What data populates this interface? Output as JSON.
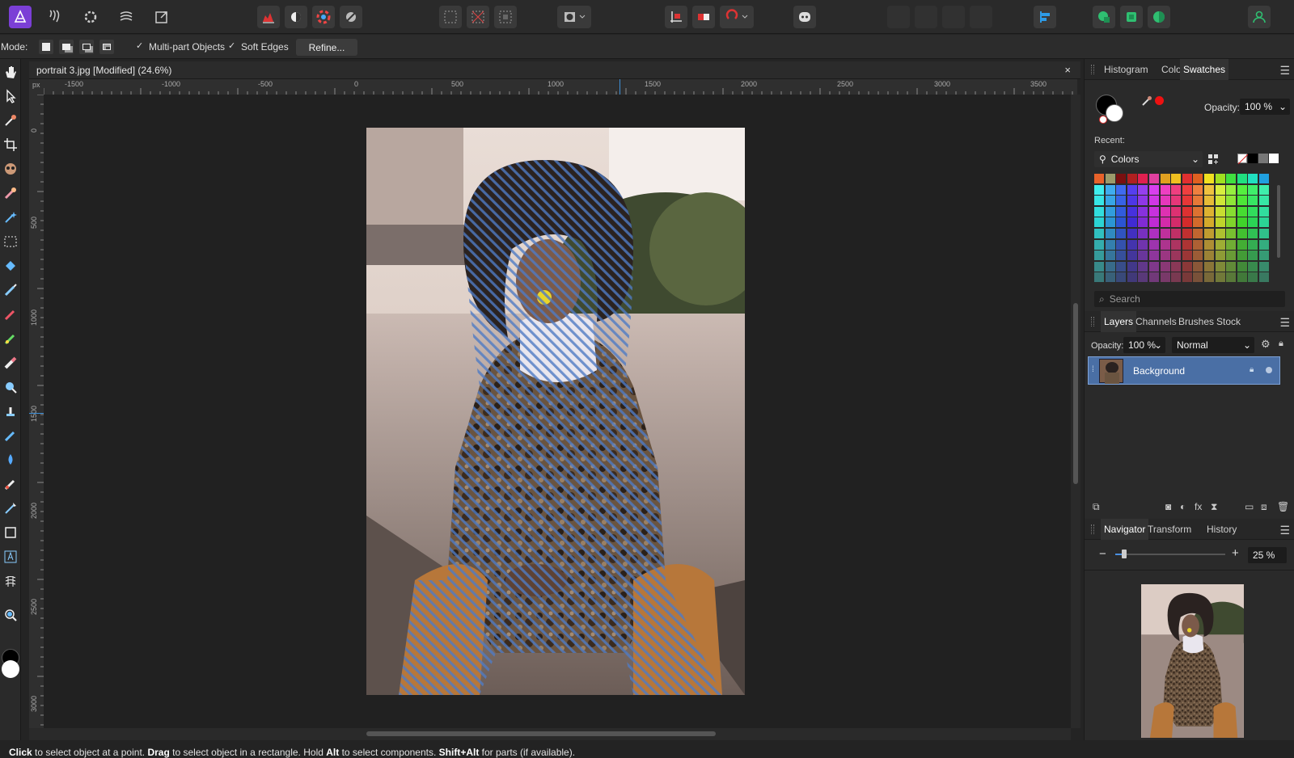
{
  "toolbar": {
    "persona_icons": [
      "affinity-photo-logo-icon",
      "liquify-persona-icon",
      "develop-persona-icon",
      "tone-mapping-persona-icon",
      "export-persona-icon"
    ],
    "adjust_icons": [
      "levels-icon",
      "auto-contrast-icon",
      "auto-color-icon",
      "auto-white-balance-icon"
    ],
    "selection_icons": [
      "select-all-icon",
      "deselect-icon",
      "invert-selection-icon"
    ],
    "quickmask_icon": "quick-mask-icon",
    "mode_icons": [
      "insert-target-icon",
      "assistant-icon"
    ],
    "right_icons": [
      "align-icon",
      "snapping-icon",
      "arrange-icon",
      "user-icon"
    ]
  },
  "context": {
    "mode_label": "Mode:",
    "multipart_label": "Multi-part Objects",
    "soft_edges_label": "Soft Edges",
    "refine_label": "Refine..."
  },
  "document": {
    "title": "portrait 3.jpg [Modified] (24.6%)",
    "close": "×",
    "ruler_unit": "px",
    "h_ticks": [
      "-1500",
      "-1000",
      "-500",
      "0",
      "500",
      "1000",
      "1500",
      "2000",
      "2500",
      "3000",
      "3500"
    ],
    "v_ticks": [
      "0",
      "500",
      "1000",
      "1500",
      "2000",
      "2500",
      "3000"
    ]
  },
  "status": {
    "w1": "Click",
    "t1": " to select object at a point. ",
    "w2": "Drag",
    "t2": " to select object in a rectangle. Hold ",
    "w3": "Alt",
    "t3": " to select components. ",
    "w4": "Shift+Alt",
    "t4": " for parts (if available)."
  },
  "swatches_panel": {
    "tabs": [
      "Histogram",
      "Color",
      "Swatches"
    ],
    "active": "Swatches",
    "opacity_label": "Opacity:",
    "opacity_value": "100 %",
    "recent_label": "Recent:",
    "palette_name": "Colors",
    "search_placeholder": "Search"
  },
  "layers_panel": {
    "tabs": [
      "Layers",
      "Channels",
      "Brushes",
      "Stock"
    ],
    "active": "Layers",
    "opacity_label": "Opacity:",
    "opacity_value": "100 %",
    "blend_mode": "Normal",
    "layers": [
      {
        "name": "Background",
        "selected": true
      }
    ]
  },
  "navigator_panel": {
    "tabs": [
      "Navigator",
      "Transform",
      "History"
    ],
    "active": "Navigator",
    "zoom_value": "25 %",
    "zoom_level": 0.08
  },
  "colors": {
    "accent": "#4a6fa5",
    "selection": "#5a82c8",
    "bg": "#242424"
  }
}
